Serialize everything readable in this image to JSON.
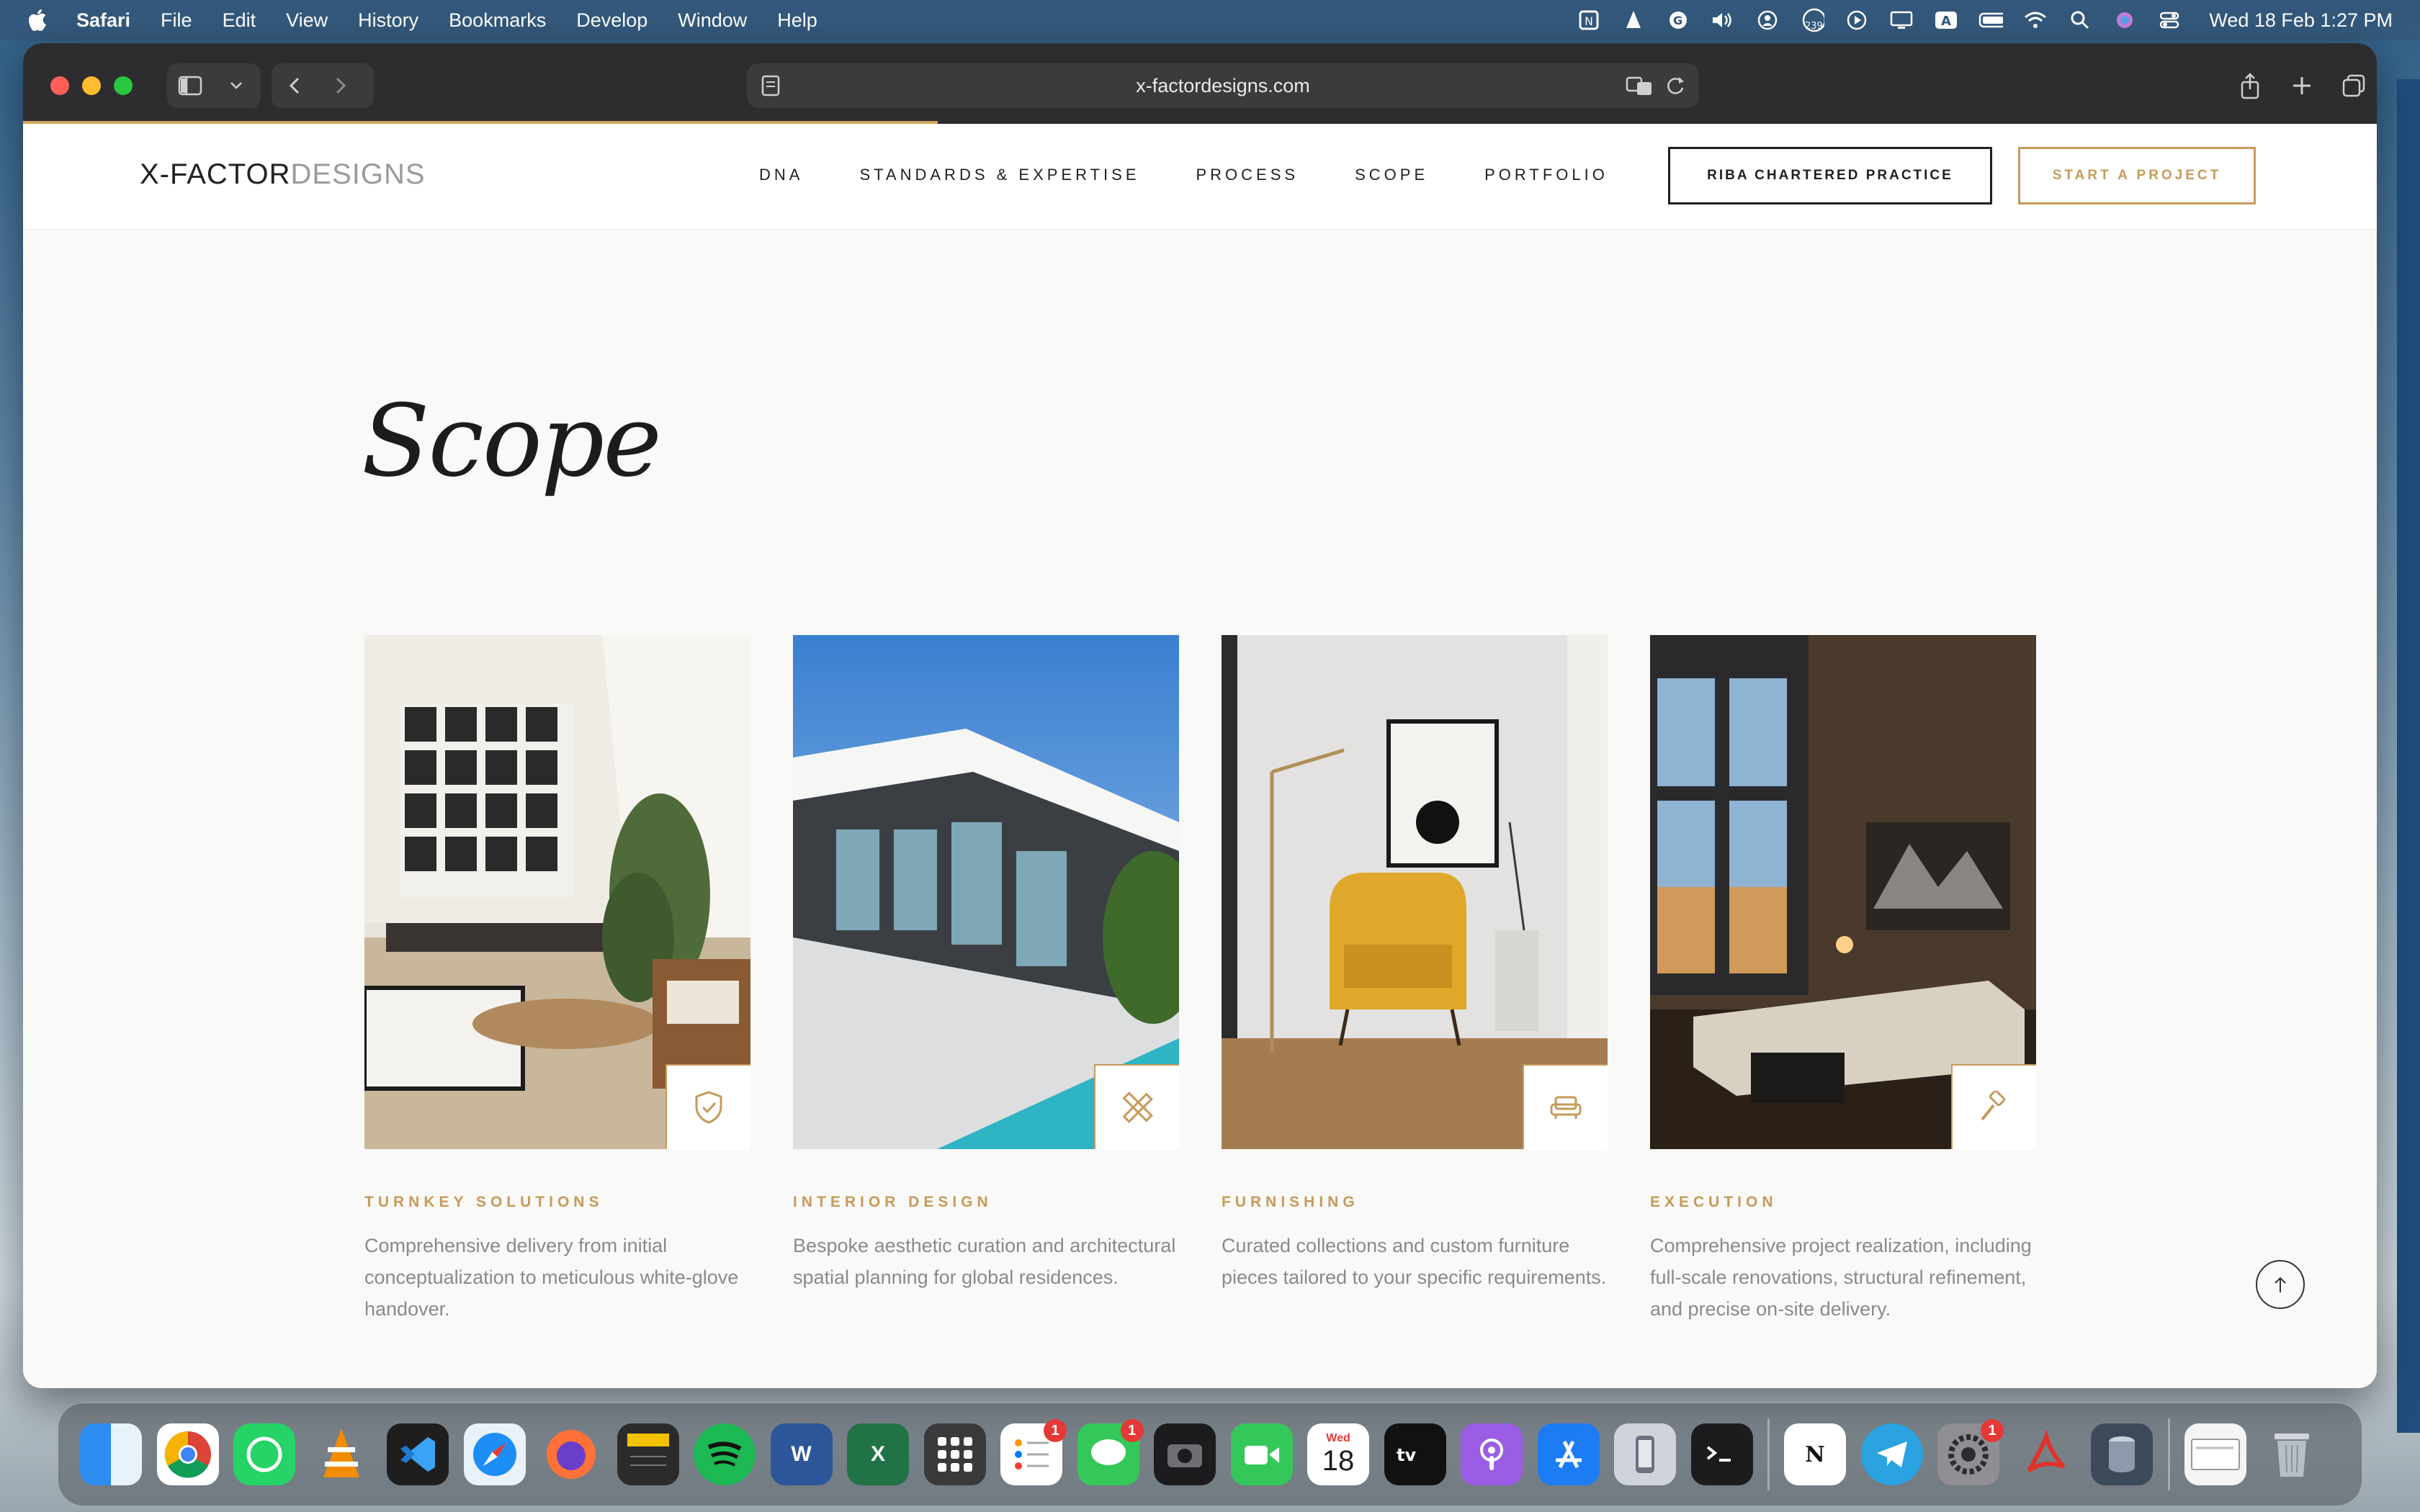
{
  "menubar": {
    "app": "Safari",
    "menus": [
      "File",
      "Edit",
      "View",
      "History",
      "Bookmarks",
      "Develop",
      "Window",
      "Help"
    ],
    "clock": "Wed 18 Feb  1:27 PM",
    "notification_count": "239"
  },
  "browser": {
    "url": "x-factordesigns.com"
  },
  "site": {
    "logo_dark": "X-FACTOR",
    "logo_light": "DESIGNS",
    "nav": [
      "DNA",
      "STANDARDS & EXPERTISE",
      "PROCESS",
      "SCOPE",
      "PORTFOLIO"
    ],
    "riba_button": "RIBA CHARTERED PRACTICE",
    "start_button": "START A PROJECT"
  },
  "scope": {
    "title": "Scope",
    "cards": [
      {
        "title": "TURNKEY SOLUTIONS",
        "desc": "Comprehensive delivery from initial conceptualization to meticulous white-glove handover.",
        "icon": "shield-check-icon"
      },
      {
        "title": "INTERIOR DESIGN",
        "desc": "Bespoke aesthetic curation and architectural spatial planning for global residences.",
        "icon": "ruler-pencil-icon"
      },
      {
        "title": "FURNISHING",
        "desc": "Curated collections and custom furniture pieces tailored to your specific requirements.",
        "icon": "sofa-icon"
      },
      {
        "title": "EXECUTION",
        "desc": "Comprehensive project realization, including full-scale renovations, structural refinement, and precise on-site delivery.",
        "icon": "hammer-icon"
      }
    ]
  },
  "dock": {
    "calendar_month": "Wed",
    "calendar_day": "18",
    "badge_one": "1"
  },
  "colors": {
    "accent": "#c79a5a",
    "menubar": "#34587a",
    "toolbar": "#2d2d2f"
  }
}
